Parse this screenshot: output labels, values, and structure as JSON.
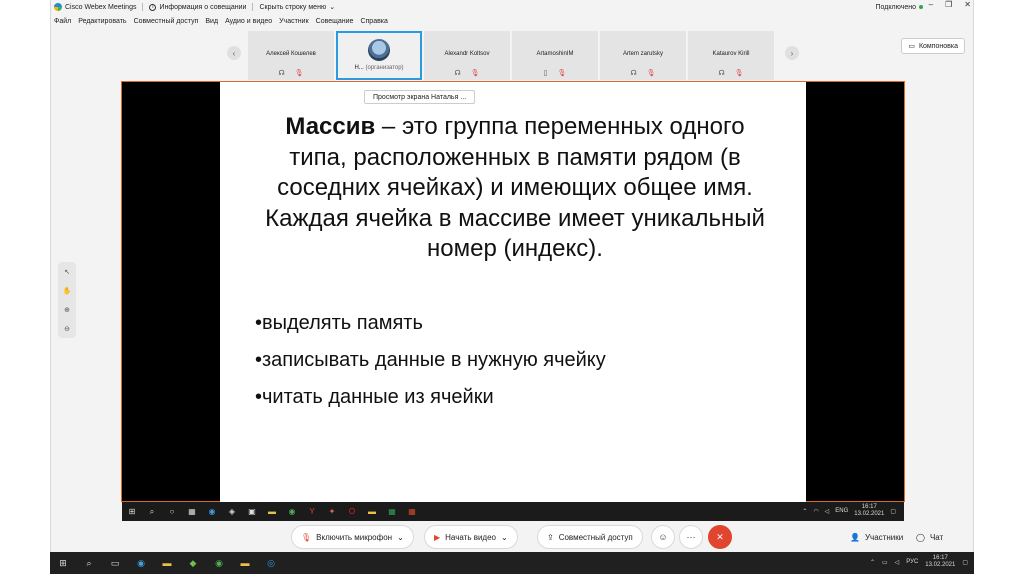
{
  "titlebar": {
    "app_title": "Cisco Webex Meetings",
    "meeting_info": "Информация о совещании",
    "hide_menu": "Скрыть строку меню",
    "hide_menu_arrow": "⌄",
    "status": "Подключено",
    "status_color": "#2aa84a"
  },
  "menu": [
    "Файл",
    "Редактировать",
    "Совместный доступ",
    "Вид",
    "Аудио и видео",
    "Участник",
    "Совещание",
    "Справка"
  ],
  "participants": [
    {
      "name": "Алексей Кошелев"
    },
    {
      "name": "Н...",
      "role": "(организатор)",
      "active": true
    },
    {
      "name": "Alexandr Koltsov"
    },
    {
      "name": "ArtamoshinIM"
    },
    {
      "name": "Artem zarutsky"
    },
    {
      "name": "Kataurov Kirill"
    }
  ],
  "layout_button": "Компоновка",
  "share_label": "Просмотр экрана Наталья ...",
  "slide": {
    "term": "Массив",
    "definition": " – это группа переменных одного типа, расположенных в памяти рядом (в соседних ячейках) и имеющих общее имя. Каждая ячейка в массиве имеет уникальный номер (индекс).",
    "bullets": [
      "•выделять память",
      "•записывать данные в нужную ячейку",
      "•читать данные из ячейки"
    ]
  },
  "inner_tray": {
    "lang": "ENG",
    "time": "16:17",
    "date": "13.02.2021"
  },
  "controls": {
    "mic": "Включить микрофон",
    "video": "Начать видео",
    "share": "Совместный доступ",
    "participants": "Участники",
    "chat": "Чат",
    "end_color": "#e0452f"
  },
  "tray": {
    "lang": "РУС",
    "time": "16:17",
    "date": "13.02.2021"
  }
}
